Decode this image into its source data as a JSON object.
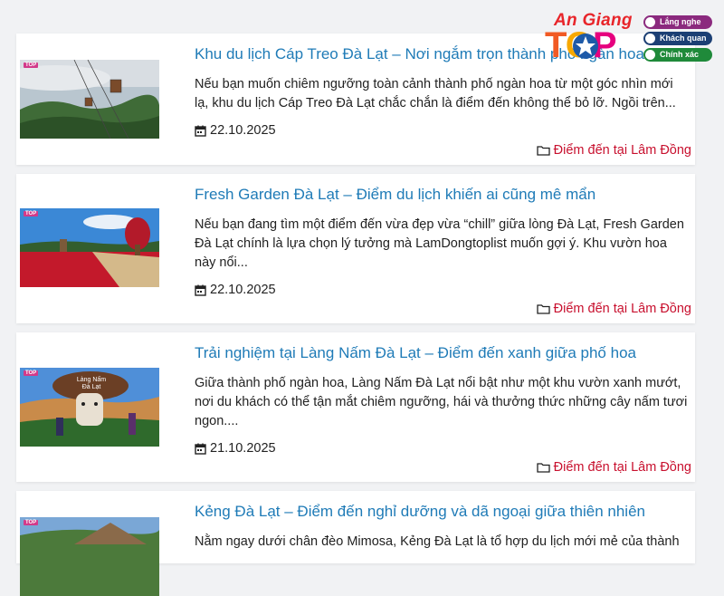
{
  "logo": {
    "brand": "An Giang",
    "word": [
      "T",
      "O",
      "P"
    ],
    "badges": [
      {
        "label": "Lắng nghe",
        "color": "#8b2a7e"
      },
      {
        "label": "Khách quan",
        "color": "#1c3f74"
      },
      {
        "label": "Chính xác",
        "color": "#1f8a3a"
      }
    ]
  },
  "posts": [
    {
      "title": "Khu du lịch Cáp Treo Đà Lạt – Nơi ngắm trọn thành phố ngàn hoa",
      "excerpt": "Nếu bạn muốn chiêm ngưỡng toàn cảnh thành phố ngàn hoa từ một góc nhìn mới lạ, khu du lịch Cáp Treo Đà Lạt chắc chắn là điểm đến không thể bỏ lỡ. Ngồi trên...",
      "date": "22.10.2025",
      "category": "Điểm đến tại Lâm Đồng",
      "thumb_icon": "cable-car-photo"
    },
    {
      "title": "Fresh Garden Đà Lạt – Điểm du lịch khiến ai cũng mê mẩn",
      "excerpt": "Nếu bạn đang tìm một điểm đến vừa đẹp vừa “chill” giữa lòng Đà Lạt, Fresh Garden Đà Lạt chính là lựa chọn lý tưởng mà LamDongtoplist muốn gợi ý. Khu vườn hoa này nổi...",
      "date": "22.10.2025",
      "category": "Điểm đến tại Lâm Đồng",
      "thumb_icon": "flower-garden-photo"
    },
    {
      "title": "Trải nghiệm tại Làng Nấm Đà Lạt – Điểm đến xanh giữa phố hoa",
      "excerpt": "Giữa thành phố ngàn hoa, Làng Nấm Đà Lạt nổi bật như một khu vườn xanh mướt, nơi du khách có thể tận mắt chiêm ngưỡng, hái và thưởng thức những cây nấm tươi ngon....",
      "date": "21.10.2025",
      "category": "Điểm đến tại Lâm Đồng",
      "thumb_icon": "mushroom-village-photo",
      "thumb_sign": "Làng Nấm Đà Lạt"
    },
    {
      "title": "Kẻng Đà Lạt – Điểm đến nghỉ dưỡng và dã ngoại giữa thiên nhiên",
      "excerpt": "Nằm ngay dưới chân đèo Mimosa, Kẻng Đà Lạt là tổ hợp du lịch mới mẻ của thành",
      "date": "",
      "category": "",
      "thumb_icon": "resort-photo"
    }
  ]
}
